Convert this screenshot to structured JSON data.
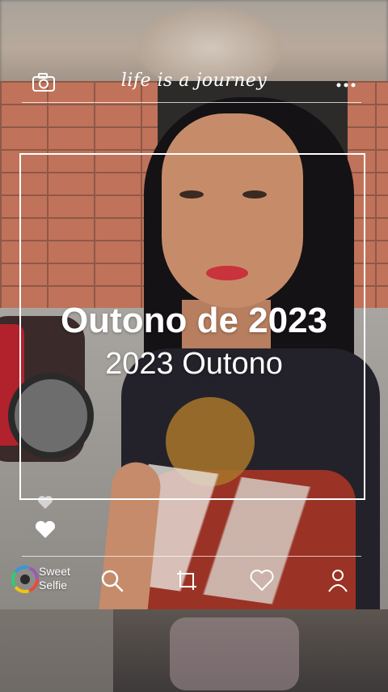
{
  "header": {
    "title": "life is a journey",
    "camera_icon": "camera-icon",
    "more_icon": "more-icon"
  },
  "overlay": {
    "headline": "Outono de 2023",
    "subline": "2023 Outono"
  },
  "footer": {
    "logo_line1": "Sweet",
    "logo_line2": "Selfie",
    "icons": [
      "search-icon",
      "crop-icon",
      "heart-icon",
      "profile-icon"
    ]
  },
  "colors": {
    "overlay_text": "#ffffff",
    "logo_ring": [
      "#e74c3c",
      "#f1c40f",
      "#2ecc71",
      "#3498db",
      "#9b59b6"
    ]
  }
}
